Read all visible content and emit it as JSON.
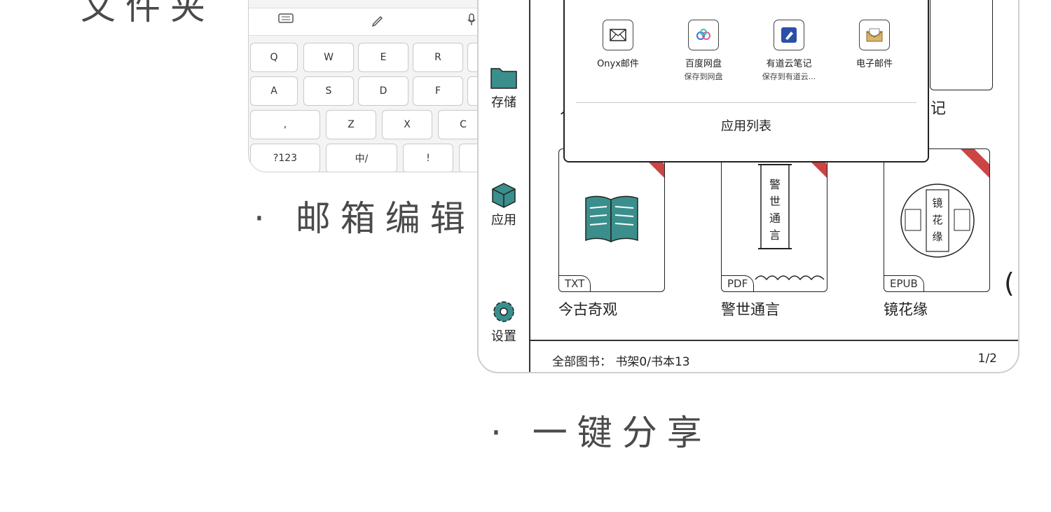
{
  "captions": {
    "top": "文件夹",
    "mail": "· 邮箱编辑",
    "share": "· 一键分享"
  },
  "keyboard": {
    "row1": [
      "Q",
      "W",
      "E",
      "R"
    ],
    "row2": [
      "A",
      "S",
      "D",
      "F"
    ],
    "row3": [
      ",",
      "Z",
      "X",
      "C"
    ],
    "row4": [
      "?123",
      "中/",
      "!"
    ]
  },
  "sidebar": {
    "items": [
      {
        "label": "存储",
        "icon": "folder-icon"
      },
      {
        "label": "应用",
        "icon": "cube-icon"
      },
      {
        "label": "设置",
        "icon": "gear-icon"
      }
    ]
  },
  "share": {
    "items": [
      {
        "name": "Onyx邮件",
        "sub": "",
        "icon": "mail-icon"
      },
      {
        "name": "百度网盘",
        "sub": "保存到网盘",
        "icon": "baidu-cloud-icon"
      },
      {
        "name": "有道云笔记",
        "sub": "保存到有道云...",
        "icon": "youdao-note-icon"
      },
      {
        "name": "电子邮件",
        "sub": "",
        "icon": "envelope-icon"
      }
    ],
    "app_list": "应用列表"
  },
  "books": [
    {
      "title": "今古奇观",
      "format": "TXT"
    },
    {
      "title": "警世通言",
      "format": "PDF"
    },
    {
      "title": "镜花缘",
      "format": "EPUB"
    }
  ],
  "partial": {
    "left_char": "人",
    "right_char": "记",
    "edge_char": "("
  },
  "footer": {
    "count": "全部图书： 书架0/书本13",
    "page": "1/2"
  },
  "colors": {
    "accent": "#3a8f8c",
    "ribbon": "#c44444"
  }
}
